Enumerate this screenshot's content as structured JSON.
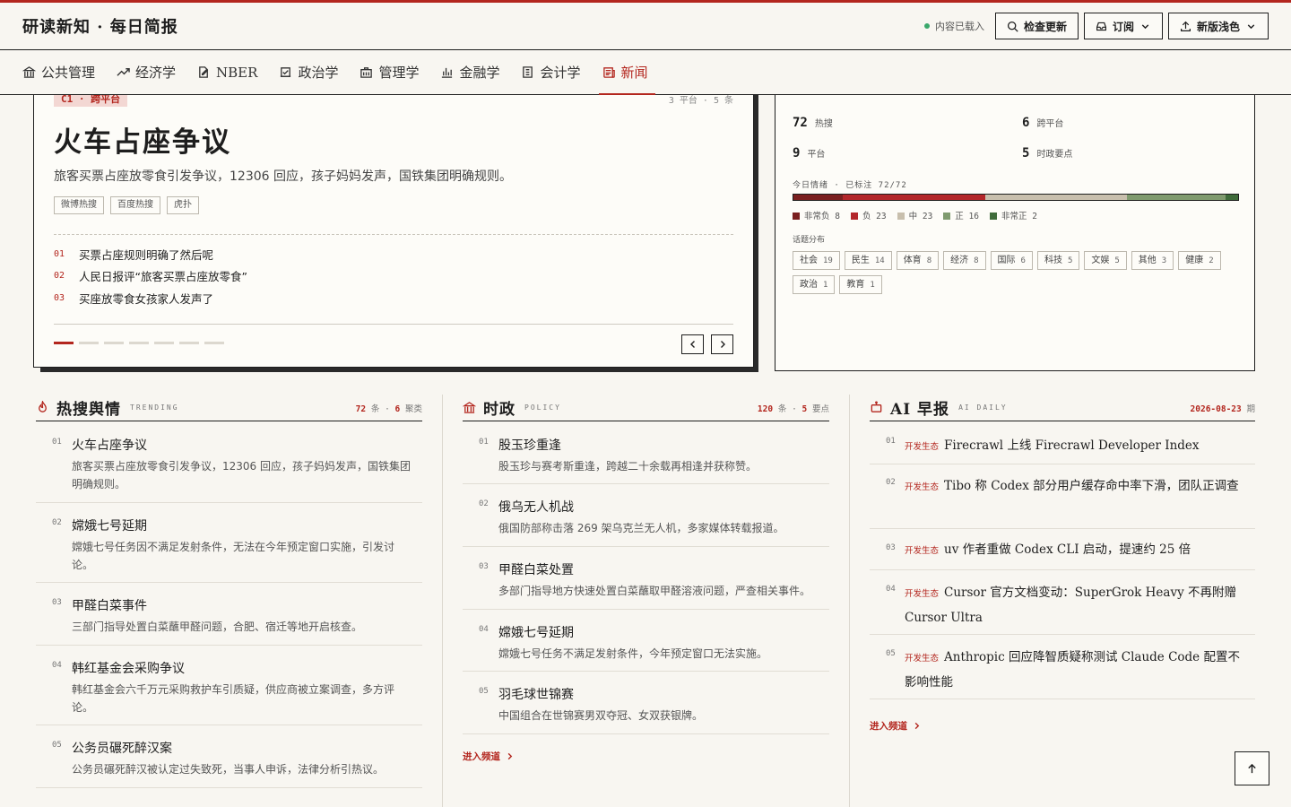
{
  "header": {
    "brand": "研读新知 · 每日简报",
    "status": "内容已载入",
    "check_update": "检查更新",
    "subscribe": "订阅",
    "theme": "新版浅色"
  },
  "nav": [
    {
      "label": "公共管理",
      "icon": "bank-icon"
    },
    {
      "label": "经济学",
      "icon": "trend-icon"
    },
    {
      "label": "NBER",
      "icon": "doc-edit-icon"
    },
    {
      "label": "政治学",
      "icon": "ballot-icon"
    },
    {
      "label": "管理学",
      "icon": "briefcase-icon"
    },
    {
      "label": "金融学",
      "icon": "bar-chart-icon"
    },
    {
      "label": "会计学",
      "icon": "invoice-icon"
    },
    {
      "label": "新闻",
      "icon": "newspaper-icon",
      "active": true
    }
  ],
  "hero": {
    "tag": "C1 · 跨平台",
    "meta": "3 平台 · 5 条",
    "title": "火车占座争议",
    "summary": "旅客买票占座放零食引发争议，12306 回应，孩子妈妈发声，国铁集团明确规则。",
    "chips": [
      "微博热搜",
      "百度热搜",
      "虎扑"
    ],
    "list": [
      {
        "num": "01",
        "text": "买票占座规则明确了然后呢"
      },
      {
        "num": "02",
        "text": "人民日报评“旅客买票占座放零食”"
      },
      {
        "num": "03",
        "text": "买座放零食女孩家人发声了"
      }
    ],
    "dots_total": 7,
    "dots_active": 0
  },
  "stats": {
    "hot": {
      "value": "72",
      "label": "热搜"
    },
    "cross": {
      "value": "6",
      "label": "跨平台"
    },
    "platform": {
      "value": "9",
      "label": "平台"
    },
    "policy": {
      "value": "5",
      "label": "时政要点"
    },
    "mood_label": "今日情绪 · 已标注 72/72",
    "mood": [
      {
        "label": "非常负",
        "count": 8,
        "color": "#7a1f1f"
      },
      {
        "label": "负",
        "count": 23,
        "color": "#b3262a"
      },
      {
        "label": "中",
        "count": 23,
        "color": "#c8bfad"
      },
      {
        "label": "正",
        "count": 16,
        "color": "#7f9a6e"
      },
      {
        "label": "非常正",
        "count": 2,
        "color": "#3f6b3a"
      }
    ],
    "topic_label": "话题分布",
    "topics": [
      {
        "name": "社会",
        "count": "19"
      },
      {
        "name": "民生",
        "count": "14"
      },
      {
        "name": "体育",
        "count": "8"
      },
      {
        "name": "经济",
        "count": "8"
      },
      {
        "name": "国际",
        "count": "6"
      },
      {
        "name": "科技",
        "count": "5"
      },
      {
        "name": "文娱",
        "count": "5"
      },
      {
        "name": "其他",
        "count": "3"
      },
      {
        "name": "健康",
        "count": "2"
      },
      {
        "name": "政治",
        "count": "1"
      },
      {
        "name": "教育",
        "count": "1"
      }
    ]
  },
  "trending": {
    "title": "热搜舆情",
    "sub": "TRENDING",
    "count_a": "72",
    "unit_a": "条",
    "count_b": "6",
    "unit_b": "聚类",
    "items": [
      {
        "num": "01",
        "title": "火车占座争议",
        "summary": "旅客买票占座放零食引发争议，12306 回应，孩子妈妈发声，国铁集团明确规则。"
      },
      {
        "num": "02",
        "title": "嫦娥七号延期",
        "summary": "嫦娥七号任务因不满足发射条件，无法在今年预定窗口实施，引发讨论。"
      },
      {
        "num": "03",
        "title": "甲醛白菜事件",
        "summary": "三部门指导处置白菜蘸甲醛问题，合肥、宿迁等地开启核查。"
      },
      {
        "num": "04",
        "title": "韩红基金会采购争议",
        "summary": "韩红基金会六千万元采购救护车引质疑，供应商被立案调查，多方评论。"
      },
      {
        "num": "05",
        "title": "公务员碾死醉汉案",
        "summary": "公务员碾死醉汉被认定过失致死，当事人申诉，法律分析引热议。"
      }
    ]
  },
  "policy": {
    "title": "时政",
    "sub": "POLICY",
    "count_a": "120",
    "unit_a": "条",
    "count_b": "5",
    "unit_b": "要点",
    "items": [
      {
        "num": "01",
        "title": "股玉珍重逢",
        "summary": "股玉珍与赛考斯重逢，跨越二十余载再相逢并获称赞。"
      },
      {
        "num": "02",
        "title": "俄乌无人机战",
        "summary": "俄国防部称击落 269 架乌克兰无人机，多家媒体转载报道。"
      },
      {
        "num": "03",
        "title": "甲醛白菜处置",
        "summary": "多部门指导地方快速处置白菜蘸取甲醛溶液问题，严查相关事件。"
      },
      {
        "num": "04",
        "title": "嫦娥七号延期",
        "summary": "嫦娥七号任务不满足发射条件，今年预定窗口无法实施。"
      },
      {
        "num": "05",
        "title": "羽毛球世锦赛",
        "summary": "中国组合在世锦赛男双夺冠、女双获银牌。"
      }
    ],
    "enter": "进入频道"
  },
  "ai": {
    "title": "AI 早报",
    "sub": "AI DAILY",
    "date": "2026-08-23",
    "date_unit": "期",
    "tag": "开发生态",
    "items": [
      {
        "num": "01",
        "title": "Firecrawl 上线 Firecrawl Developer Index"
      },
      {
        "num": "02",
        "title": "Tibo 称 Codex 部分用户缓存命中率下滑，团队正调查"
      },
      {
        "num": "03",
        "title": "uv 作者重做 Codex CLI 启动，提速约 25 倍"
      },
      {
        "num": "04",
        "title": "Cursor 官方文档变动：SuperGrok Heavy 不再附赠 Cursor Ultra"
      },
      {
        "num": "05",
        "title": "Anthropic 回应降智质疑称测试 Claude Code 配置不影响性能"
      }
    ],
    "enter": "进入频道"
  }
}
